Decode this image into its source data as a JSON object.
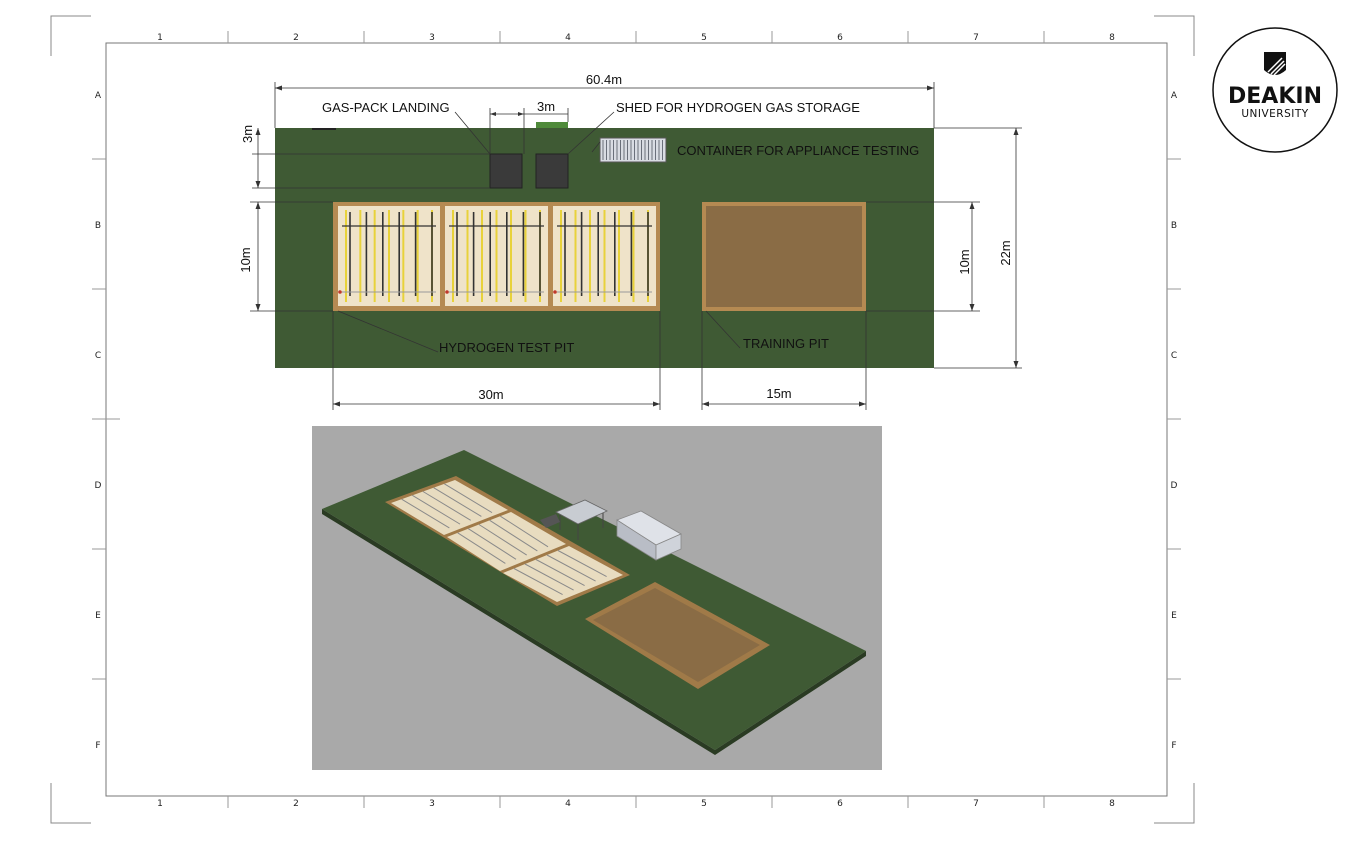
{
  "sheet": {
    "col_labels": [
      "1",
      "2",
      "3",
      "4",
      "5",
      "6",
      "7",
      "8"
    ],
    "row_labels": [
      "A",
      "B",
      "C",
      "D",
      "E",
      "F"
    ]
  },
  "logo": {
    "line1": "DEAKIN",
    "line2": "UNIVERSITY"
  },
  "plan": {
    "labels": {
      "gas_pack_landing": "GAS-PACK LANDING",
      "shed": "SHED FOR HYDROGEN GAS STORAGE",
      "container": "CONTAINER FOR APPLIANCE TESTING",
      "hydrogen_pit": "HYDROGEN TEST PIT",
      "training_pit": "TRAINING PIT"
    },
    "dimensions": {
      "overall_length": "60.4m",
      "shed_width": "3m",
      "landing_depth": "3m",
      "pit_depth_left": "10m",
      "pit_depth_right": "10m",
      "site_width": "22m",
      "hydrogen_pit_length": "30m",
      "training_pit_length": "15m"
    }
  },
  "colors": {
    "ground": "#3f5a34",
    "pit_frame": "#b58a52",
    "training_pit_fill": "#8a6c45",
    "hydrogen_pit_fill": "#efe3c9",
    "yellow_line": "#e8d23a",
    "render_bg": "#a9a9a9"
  }
}
